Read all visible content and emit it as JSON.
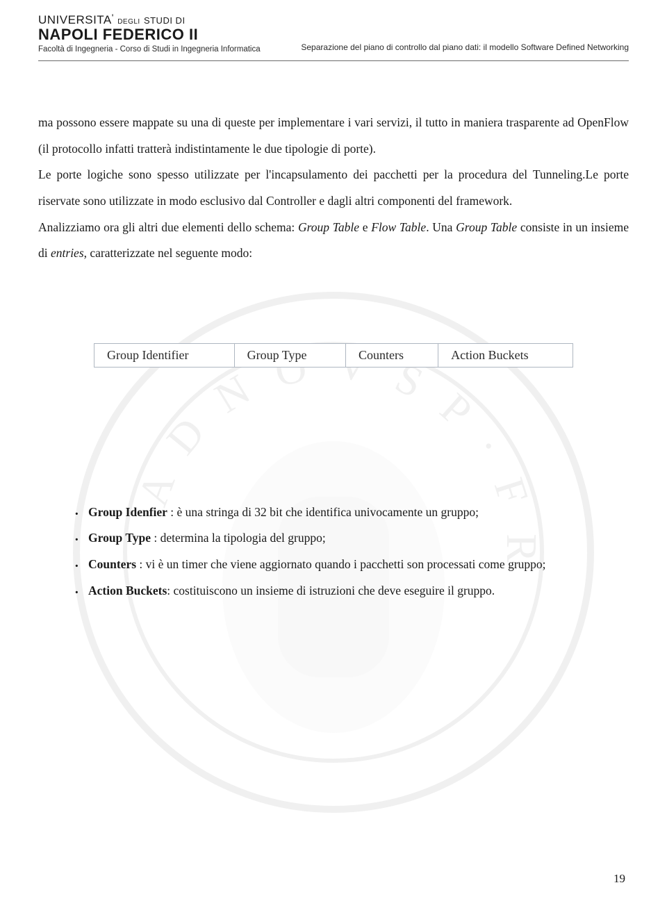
{
  "header": {
    "logo_uni": "UNIVERSITA",
    "logo_degli": "DEGLI",
    "logo_studi_di": "STUDI DI",
    "logo_napoli": "NAPOLI FEDERICO II",
    "sub": "Facoltà di Ingegneria - Corso di Studi in Ingegneria Informatica",
    "right": "Separazione del piano di controllo dal piano dati: il modello Software Defined Networking"
  },
  "body": {
    "p1a": "ma possono essere mappate su una  di queste per implementare i vari servizi, il tutto in maniera trasparente ad OpenFlow (il protocollo infatti tratterà indistintamente le due tipologie di porte).",
    "p2": "Le porte logiche sono spesso utilizzate per l'incapsulamento dei pacchetti per la procedura del Tunneling.Le porte riservate sono utilizzate in modo esclusivo dal Controller e dagli altri componenti del framework.",
    "p3a": " Analizziamo ora gli altri due elementi dello schema: ",
    "p3b": "Group Table",
    "p3c": " e ",
    "p3d": "Flow Table",
    "p3e": ". Una ",
    "p3f": "Group Table",
    "p3g": " consiste in un insieme di ",
    "p3h": "entries",
    "p3i": ", caratterizzate nel seguente modo:"
  },
  "table": {
    "c1": "Group Identifier",
    "c2": "Group Type",
    "c3": "Counters",
    "c4": "Action Buckets"
  },
  "bullets": {
    "b1_bold": "Group Idenfier",
    "b1_rest": " : è una stringa di 32 bit che identifica univocamente un gruppo;",
    "b2_bold": "Group Type",
    "b2_rest": " : determina la tipologia del gruppo;",
    "b3_bold": "Counters",
    "b3_rest": " : vi è un timer che viene aggiornato quando i pacchetti son processati come gruppo;",
    "b4_bold": "Action Buckets",
    "b4_rest": ": costituiscono un insieme di istruzioni che deve eseguire il gruppo."
  },
  "page_number": "19"
}
